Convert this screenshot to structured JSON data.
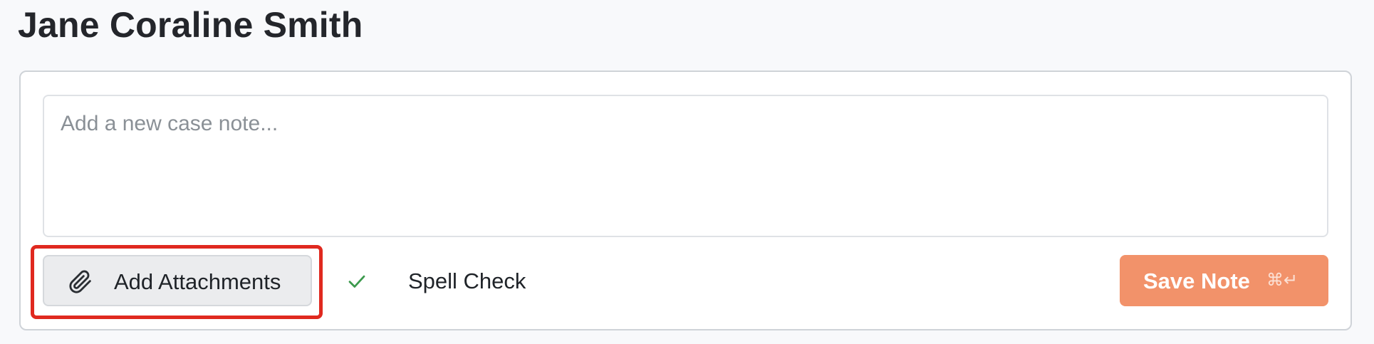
{
  "header": {
    "title": "Jane Coraline Smith"
  },
  "note_editor": {
    "placeholder": "Add a new case note...",
    "value": ""
  },
  "toolbar": {
    "attach_label": "Add Attachments",
    "attach_icon": "paperclip-icon",
    "spell_check_label": "Spell Check",
    "spell_check_icon": "checkmark-icon",
    "spell_check_enabled": true,
    "save_label": "Save Note",
    "save_shortcut": "⌘↵"
  },
  "colors": {
    "save_button": "#f2926a",
    "highlight": "#e0291f",
    "check": "#3c9a4d"
  }
}
